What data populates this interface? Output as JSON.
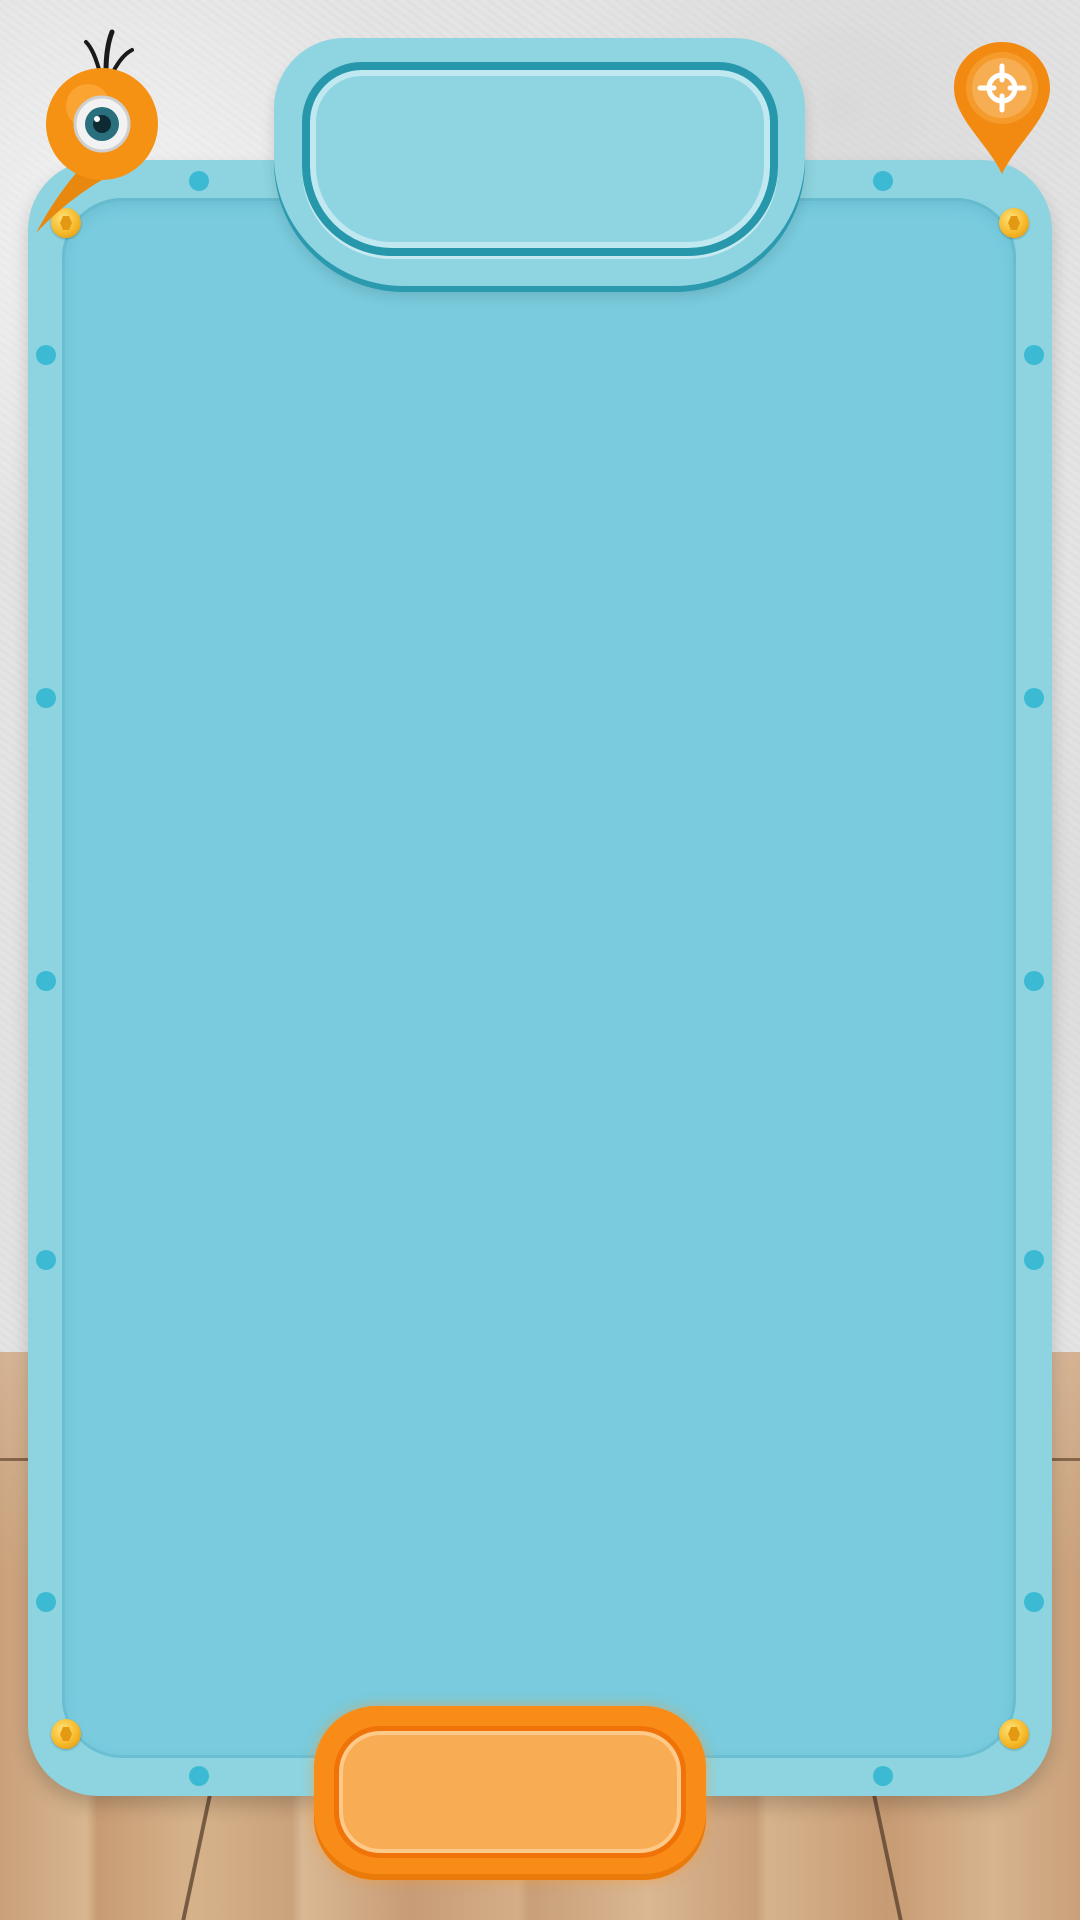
{
  "title": {
    "text": ""
  },
  "action_button": {
    "label": ""
  },
  "icons": {
    "mascot": "orange-bird-mascot-icon",
    "locate": "location-pin-crosshair-icon",
    "screw": "hex-screw-icon"
  },
  "colors": {
    "board_outer": "#8dd4e0",
    "board_inner": "#79cbdd",
    "dot": "#3dbad3",
    "accent_orange": "#f98b17"
  }
}
